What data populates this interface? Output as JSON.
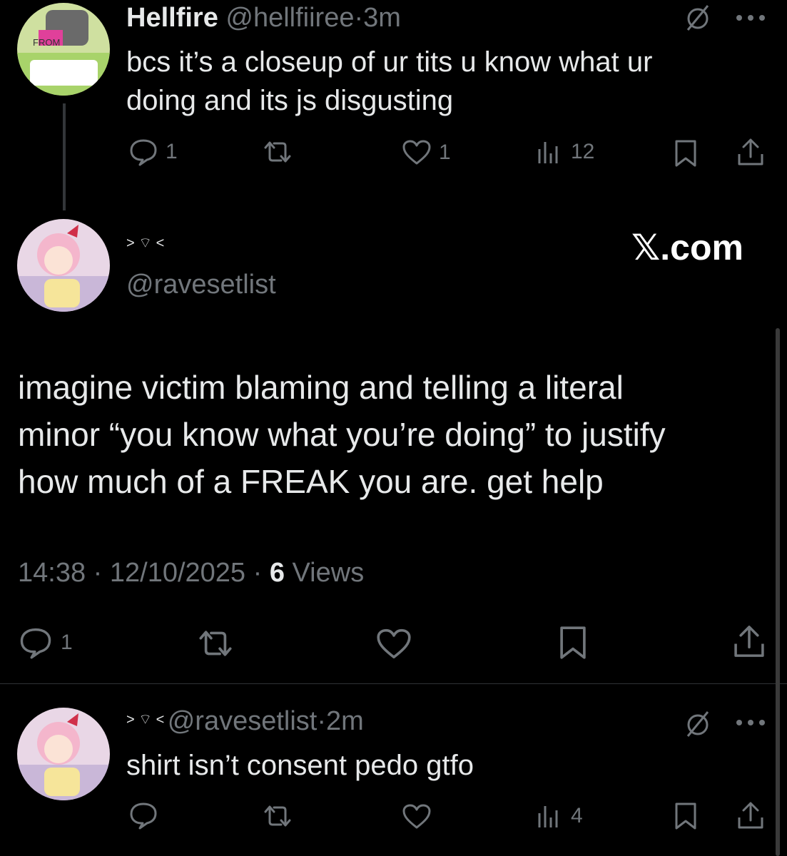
{
  "parent_reply": {
    "display_name": "Hellfire",
    "handle": "@hellfiiree",
    "separator": "·",
    "time": "3m",
    "text_line1": "bcs it’s a closeup of ur tits u know what ur",
    "text_line2": "doing and its js disgusting",
    "avatar_text": "FROM",
    "metrics": {
      "replies": "1",
      "likes": "1",
      "views": "12"
    }
  },
  "main_tweet": {
    "display_name": "> ⌔ <",
    "handle": "@ravesetlist",
    "watermark": "𝕏.com",
    "text_line1": "imagine victim blaming and telling a literal",
    "text_line2": "minor “you know what you’re doing” to justify",
    "text_line3": "how much of a FREAK you are. get help",
    "timestamp": "14:38 · 12/10/2025 · ",
    "views_count": "6",
    "views_label": " Views",
    "metrics": {
      "replies": "1"
    }
  },
  "reply": {
    "display_name": "> ⌔ <",
    "handle": "@ravesetlist",
    "separator": "·",
    "time": "2m",
    "text": "shirt isn’t consent pedo gtfo",
    "metrics": {
      "views": "4"
    }
  },
  "icons": {
    "reply": "speech-bubble-icon",
    "retweet": "retweet-icon",
    "like": "heart-icon",
    "views": "bar-chart-icon",
    "bookmark": "bookmark-icon",
    "share": "share-icon",
    "grok": "slashed-circle-icon",
    "more": "more-dots-icon"
  },
  "colors": {
    "background": "#000000",
    "text": "#e7e9ea",
    "muted": "#71767b"
  }
}
